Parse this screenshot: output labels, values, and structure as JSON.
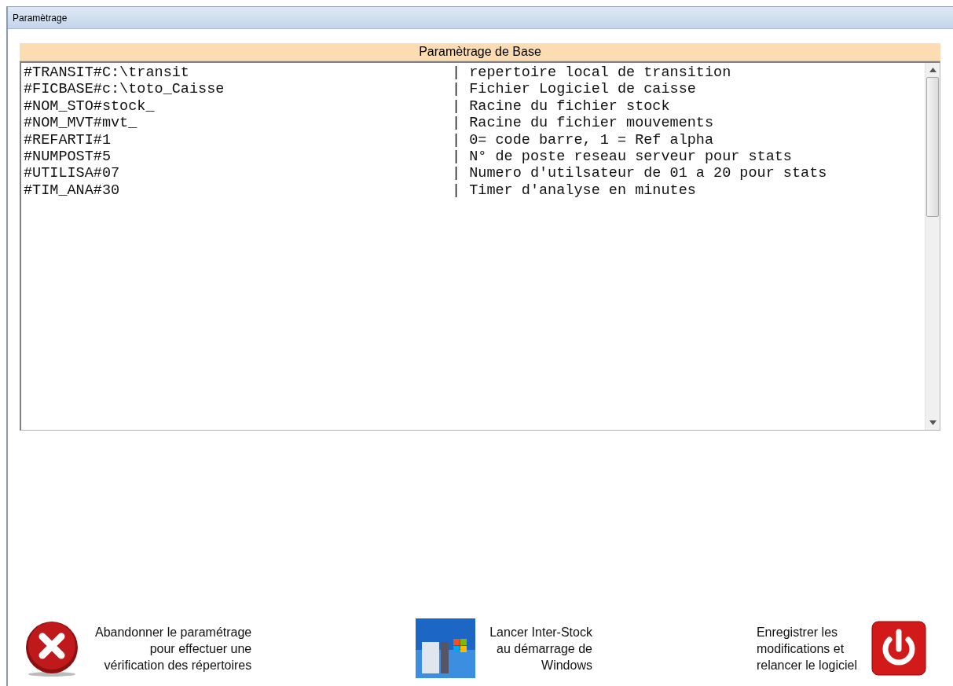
{
  "window": {
    "title": "Paramètrage"
  },
  "panel": {
    "title": "Paramètrage de Base",
    "lines": [
      {
        "setting": "#TRANSIT#C:\\transit",
        "comment": "| repertoire local de transition"
      },
      {
        "setting": "#FICBASE#c:\\toto_Caisse",
        "comment": "| Fichier Logiciel de caisse"
      },
      {
        "setting": "#NOM_STO#stock_",
        "comment": "| Racine du fichier stock"
      },
      {
        "setting": "#NOM_MVT#mvt_",
        "comment": "| Racine du fichier mouvements"
      },
      {
        "setting": "#REFARTI#1",
        "comment": "| 0= code barre, 1 = Ref alpha"
      },
      {
        "setting": "#NUMPOST#5",
        "comment": "| N° de poste reseau serveur pour stats"
      },
      {
        "setting": "#UTILISA#07",
        "comment": "| Numero d'utilsateur de 01 a 20 pour stats"
      },
      {
        "setting": "#TIM_ANA#30",
        "comment": "| Timer d'analyse en minutes"
      }
    ]
  },
  "actions": [
    {
      "kind": "cancel",
      "label": [
        "Abandonner le paramétrage",
        "pour effectuer une",
        "vérification des répertoires"
      ]
    },
    {
      "kind": "startup",
      "label": [
        "Lancer Inter-Stock",
        "au démarrage de",
        "Windows"
      ]
    },
    {
      "kind": "save",
      "label": [
        "Enregistrer les",
        "modifications et",
        "relancer le logiciel"
      ]
    }
  ]
}
